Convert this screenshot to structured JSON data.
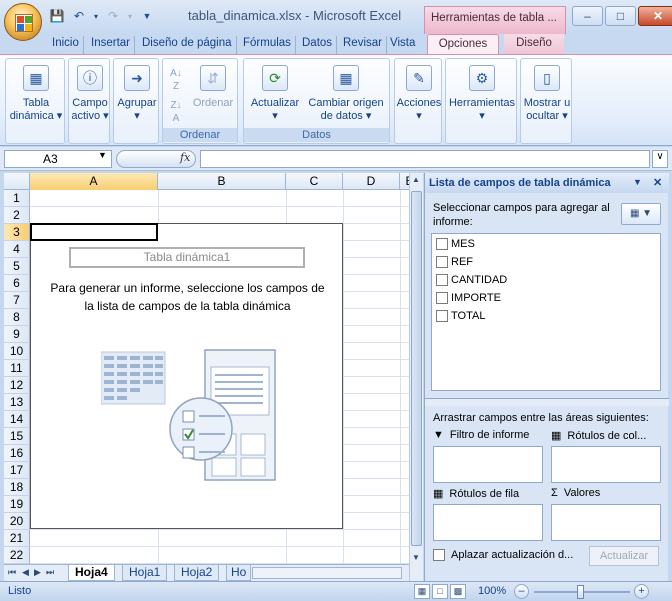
{
  "window": {
    "title": "tabla_dinamica.xlsx - Microsoft Excel",
    "contextual_tab": "Herramientas de tabla ..."
  },
  "ribbon_tabs": [
    "Inicio",
    "Insertar",
    "Diseño de página",
    "Fórmulas",
    "Datos",
    "Revisar",
    "Vista",
    "Opciones",
    "Diseño"
  ],
  "ribbon": {
    "tabla_dinamica": [
      "Tabla",
      "dinámica"
    ],
    "campo_activo": [
      "Campo",
      "activo"
    ],
    "agrupar": "Agrupar",
    "ordenar_btn": "Ordenar",
    "group_ordenar": "Ordenar",
    "actualizar": "Actualizar",
    "cambiar_origen": [
      "Cambiar origen",
      "de datos"
    ],
    "group_datos": "Datos",
    "acciones": "Acciones",
    "herramientas": "Herramientas",
    "mostrar_ocultar": [
      "Mostrar u",
      "ocultar"
    ]
  },
  "formula_bar": {
    "name_box": "A3",
    "fx": "fx",
    "formula": ""
  },
  "sheet": {
    "columns": [
      "A",
      "B",
      "C",
      "D",
      "E"
    ],
    "rows": [
      "1",
      "2",
      "3",
      "4",
      "5",
      "6",
      "7",
      "8",
      "9",
      "10",
      "11",
      "12",
      "13",
      "14",
      "15",
      "16",
      "17",
      "18",
      "19",
      "20",
      "21",
      "22"
    ],
    "pivot_name": "Tabla dinámica1",
    "pivot_message": [
      "Para generar un informe, seleccione los campos de",
      "la lista de campos de la tabla dinámica"
    ]
  },
  "sheet_tabs": [
    "Hoja4",
    "Hoja1",
    "Hoja2",
    "Ho"
  ],
  "field_list": {
    "title": "Lista de campos de tabla dinámica",
    "prompt": [
      "Seleccionar campos para agregar al",
      "informe:"
    ],
    "fields": [
      "MES",
      "REF",
      "CANTIDAD",
      "IMPORTE",
      "TOTAL"
    ],
    "drag_text": "Arrastrar campos entre las áreas siguientes:",
    "areas": {
      "filter": "Filtro de informe",
      "columns": "Rótulos de col...",
      "rows": "Rótulos de fila",
      "values": "Valores"
    },
    "defer": "Aplazar actualización d...",
    "update": "Actualizar"
  },
  "status": {
    "text": "Listo",
    "zoom": "100%"
  },
  "icons": {
    "office": "office-button-icon",
    "save": "save-icon",
    "undo": "undo-icon",
    "redo": "redo-icon",
    "help": "help-icon",
    "field_list_options": "field-list-layout-icon"
  }
}
